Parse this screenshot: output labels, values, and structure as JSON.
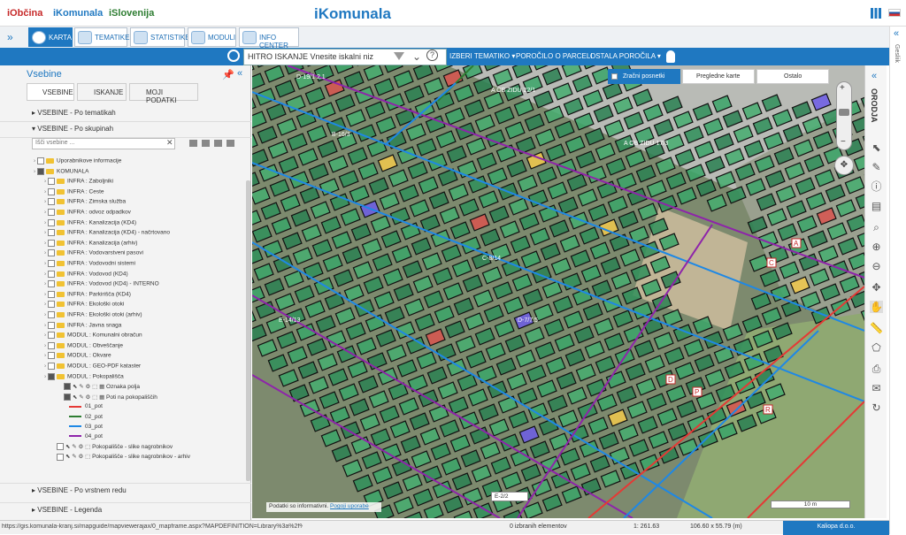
{
  "header": {
    "brand1": "iObčina",
    "brand2": "iKomunala",
    "brand3": "iSlovenija",
    "logo": "iKomunala"
  },
  "tabs": [
    {
      "label": "KARTA",
      "active": true
    },
    {
      "label": "TEMATIKE"
    },
    {
      "label": "STATISTIKE"
    },
    {
      "label": "MODULI"
    },
    {
      "label": "INFO CENTER"
    }
  ],
  "search": {
    "value": "HITRO ISKANJE Vnesite iskalni niz"
  },
  "toolbar": {
    "items": [
      "IZBERI TEMATIKO ▾",
      "POROČILO O PARCELI",
      "OSTALA POROČILA ▾"
    ]
  },
  "left": {
    "title": "Vsebine",
    "subtabs": [
      "VSEBINE",
      "ISKANJE",
      "MOJI PODATKI"
    ],
    "sections": {
      "tematikah": "VSEBINE - Po tematikah",
      "skupinah": "VSEBINE - Po skupinah",
      "redu": "VSEBINE - Po vrstnem redu",
      "legenda": "VSEBINE - Legenda"
    },
    "filter_placeholder": "Išči vsebine ..."
  },
  "tree": [
    "Uporabnikove informacije",
    "KOMUNALA",
    "INFRA : Zaboljniki",
    "INFRA : Ceste",
    "INFRA : Zimska služba",
    "INFRA : odvoz odpadkov",
    "INFRA : Kanalizacija (KD4)",
    "INFRA : Kanalizacija (KD4) - načrtovano",
    "INFRA : Kanalizacija (arhiv)",
    "INFRA : Vodovarstveni pasovi",
    "INFRA : Vodovodni sistemi",
    "INFRA : Vodovod (KD4)",
    "INFRA : Vodovod (KD4) - INTERNO",
    "INFRA : Parkirišča (KD4)",
    "INFRA : Ekološki otoki",
    "INFRA : Ekološki otoki (arhiv)",
    "INFRA : Javna snaga",
    "MODUL : Komunalni obračun",
    "MODUL : Obveščanje",
    "MODUL : Okvare",
    "MODUL : GEO-PDF kataster",
    "MODUL : Pokopališča"
  ],
  "layers": [
    "Oznaka polja",
    "Poti na pokopališčih"
  ],
  "legend": [
    {
      "label": "01_pot",
      "color": "#e53935"
    },
    {
      "label": "02_pot",
      "color": "#2e7d32"
    },
    {
      "label": "03_pot",
      "color": "#1e88e5"
    },
    {
      "label": "04_pot",
      "color": "#8e24aa"
    }
  ],
  "extra_layers": [
    "Pokopališče - slike nagrobnikov",
    "Pokopališče - slike nagrobnikov - arhiv"
  ],
  "map": {
    "layer_tabs": [
      "Zračni posnetki",
      "Pregledne karte",
      "Ostalo"
    ],
    "disclaimer": "Podatki so informativni.",
    "terms_link": "Pogoji uporabe",
    "scale_label": "10 m",
    "labels": [
      "D-19/1 2.1",
      "A OB ZIDU 22/1",
      "A OB ZIDU 17/3",
      "B-16/3",
      "C-8/14",
      "D-7/7.5",
      "E-14/13",
      "E-2/2",
      "A",
      "C",
      "D",
      "P",
      "R"
    ]
  },
  "right_title": "ORODJA",
  "edge_label": "Gesliik",
  "status": {
    "url": "https://gis.komunala-kranj.si/mapguide/mapviewerajax/0_mapframe.aspx?MAPDEFINITION=Library%3a%2f%2f03_iKomunal...",
    "selected": "0 izbranih elementov",
    "scale": "1: 261.63",
    "size": "106.60 x 55.79 (m)",
    "company": "Kaliopa d.o.o."
  }
}
